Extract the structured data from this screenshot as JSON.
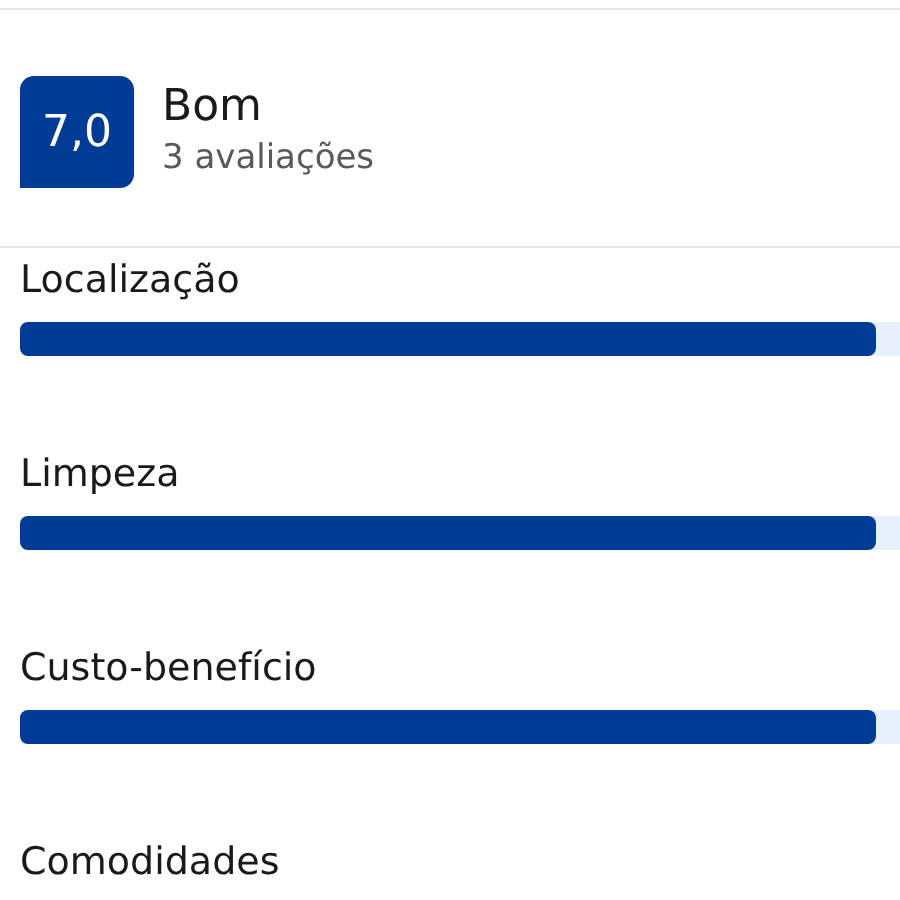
{
  "summary": {
    "score": "7,0",
    "rating": "Bom",
    "count": "3 avaliações"
  },
  "categories": [
    {
      "label": "Localização",
      "level": 0.93
    },
    {
      "label": "Limpeza",
      "level": 0.93
    },
    {
      "label": "Custo-benefício",
      "level": 0.93
    },
    {
      "label": "Comodidades"
    }
  ]
}
